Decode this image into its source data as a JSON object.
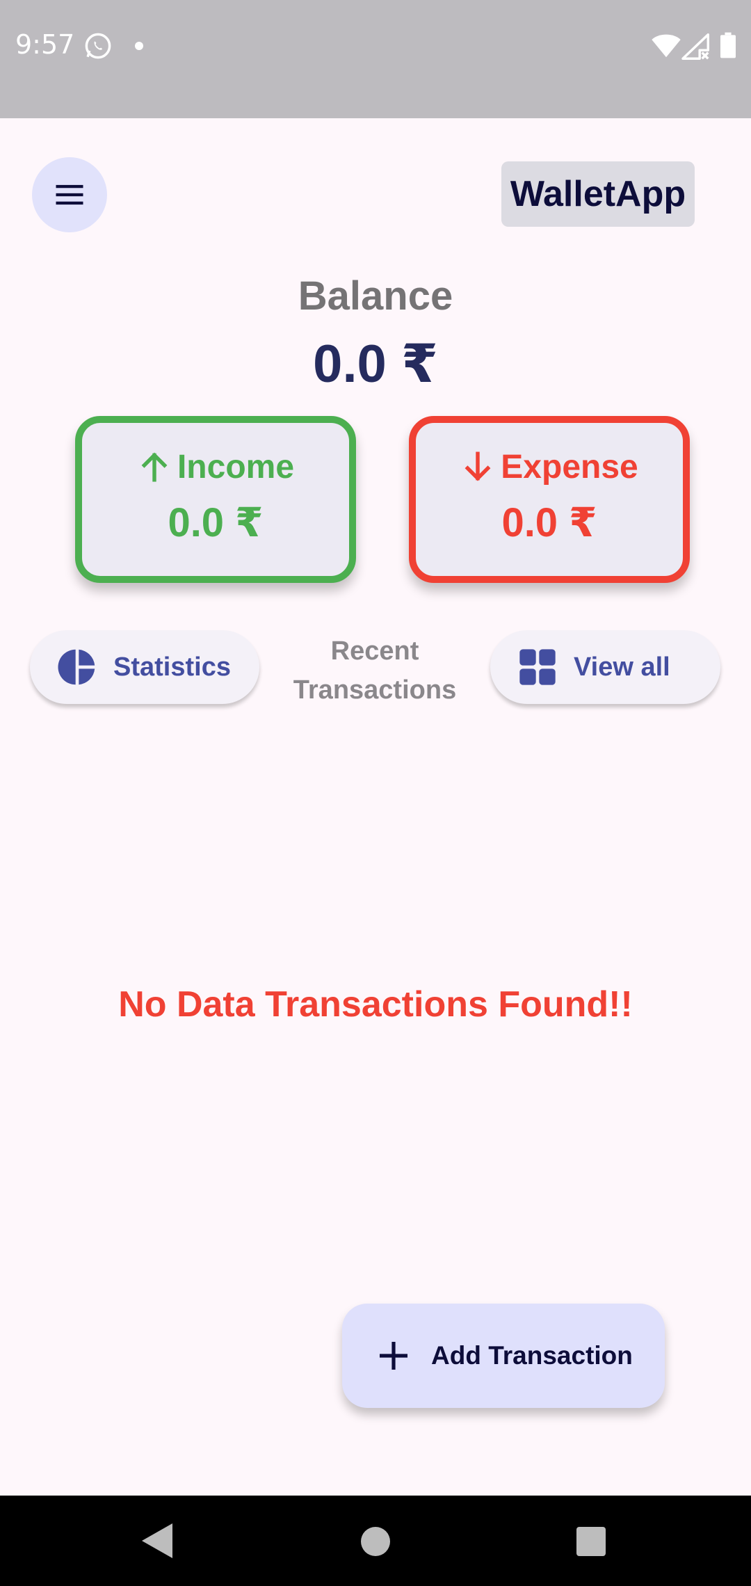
{
  "status_bar": {
    "time": "9:57",
    "icons": [
      "whatsapp-icon",
      "notification-dot-icon",
      "wifi-icon",
      "signal-icon",
      "battery-icon"
    ]
  },
  "app_bar": {
    "menu_icon": "menu-icon",
    "title": "WalletApp"
  },
  "balance": {
    "label": "Balance",
    "value": "0.0 ₹"
  },
  "income": {
    "label": "Income",
    "amount": "0.0 ₹",
    "icon": "arrow-up-icon",
    "color": "#4caf50"
  },
  "expense": {
    "label": "Expense",
    "amount": "0.0 ₹",
    "icon": "arrow-down-icon",
    "color": "#f04134"
  },
  "actions": {
    "statistics_label": "Statistics",
    "statistics_icon": "pie-chart-icon",
    "recent_label": "Recent Transactions",
    "view_all_label": "View all",
    "view_all_icon": "grid-icon"
  },
  "empty_state": {
    "message": "No Data Transactions Found!!"
  },
  "fab": {
    "label": "Add Transaction",
    "icon": "plus-icon"
  },
  "nav_bar": {
    "buttons": [
      "back-icon",
      "home-icon",
      "recents-icon"
    ]
  },
  "colors": {
    "accent": "#434ea0",
    "balance_text": "#252b5e",
    "background": "#fef7fb"
  }
}
